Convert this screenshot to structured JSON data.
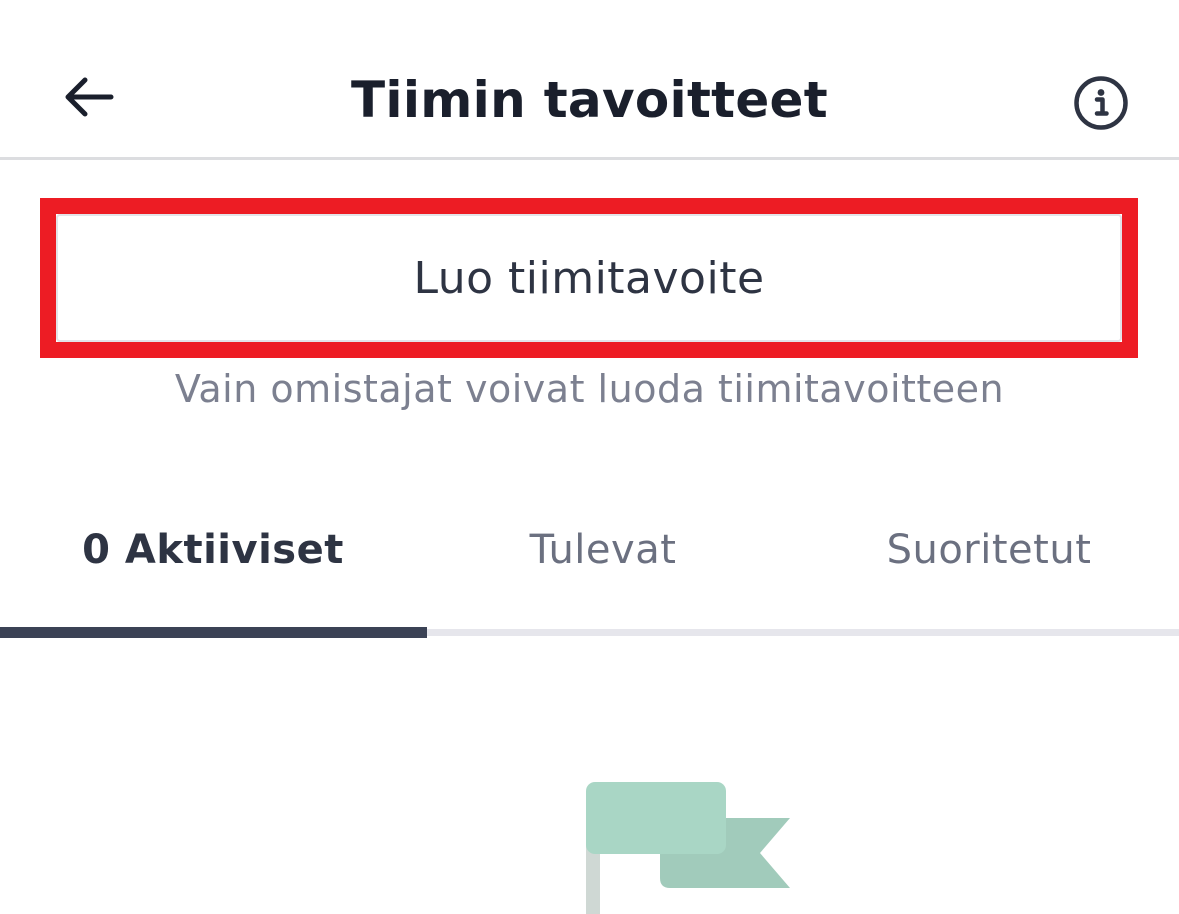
{
  "header": {
    "title": "Tiimin tavoitteet",
    "back_icon": "arrow-left-icon",
    "info_icon": "info-circle-icon"
  },
  "create": {
    "label": "Luo tiimitavoite",
    "hint": "Vain omistajat voivat luoda tiimitavoitteen",
    "highlight_color": "#ed1c24"
  },
  "tabs": [
    {
      "label": "0 Aktiiviset",
      "active": true
    },
    {
      "label": "Tulevat",
      "active": false
    },
    {
      "label": "Suoritetut",
      "active": false
    }
  ],
  "empty_state": {
    "icon": "flag-icon",
    "colors": {
      "primary": "#a8d5c5",
      "secondary": "#9ec7b8",
      "pole": "#cfd8d4"
    }
  },
  "colors": {
    "text_dark": "#1a1f2c",
    "text_muted": "#7c8090",
    "tab_indicator": "#3b4255"
  }
}
